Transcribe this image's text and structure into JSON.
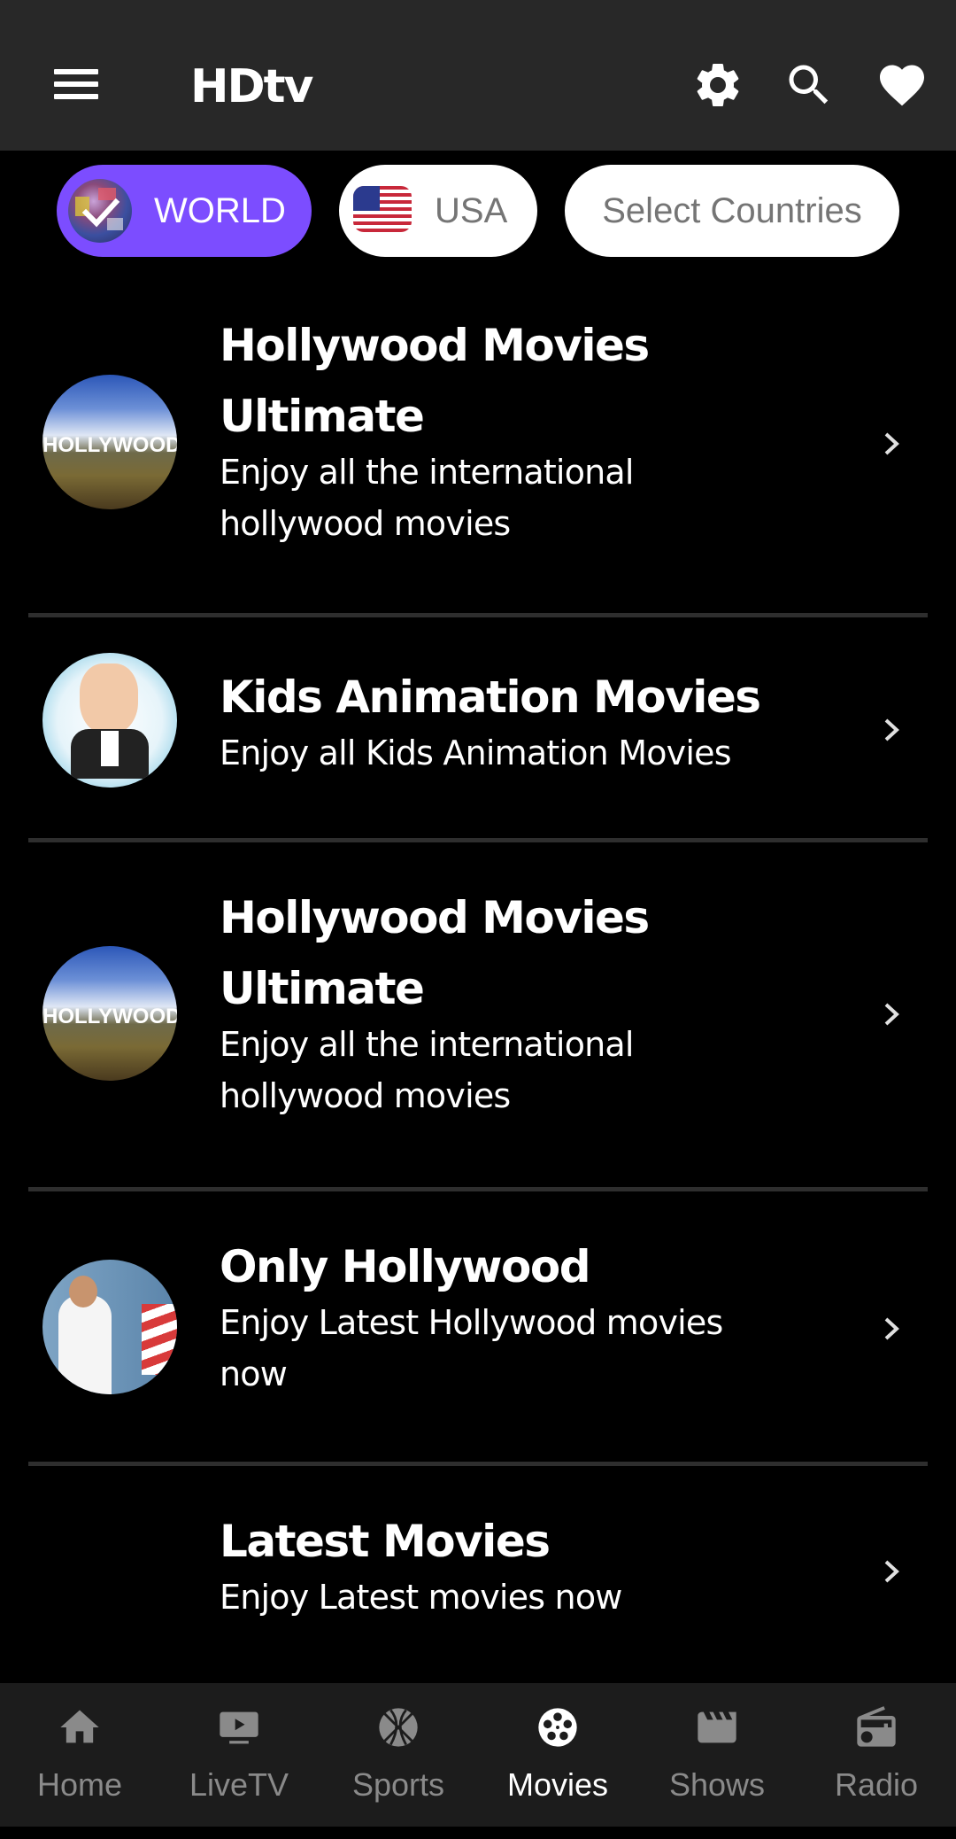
{
  "header": {
    "title": "HDtv",
    "icons": [
      "menu-icon",
      "settings-icon",
      "search-icon",
      "favorite-icon"
    ]
  },
  "chips": [
    {
      "label": "WORLD",
      "icon": "globe-check-icon",
      "selected": true,
      "color": "#7c4dff"
    },
    {
      "label": "USA",
      "icon": "usa-flag-icon",
      "selected": false
    },
    {
      "label": "Select Countries",
      "selected": false
    }
  ],
  "list": [
    {
      "title_lines": [
        "Hollywood Movies",
        "Ultimate"
      ],
      "subtitle_lines": [
        "Enjoy all the international",
        "hollywood movies"
      ],
      "image": "hollywood-sign"
    },
    {
      "title_lines": [
        "Kids Animation Movies"
      ],
      "subtitle_lines": [
        "Enjoy all  Kids Animation Movies"
      ],
      "image": "boss-baby"
    },
    {
      "title_lines": [
        "Hollywood Movies",
        "Ultimate"
      ],
      "subtitle_lines": [
        "Enjoy all the international",
        "hollywood movies"
      ],
      "image": "hollywood-sign"
    },
    {
      "title_lines": [
        "Only Hollywood"
      ],
      "subtitle_lines": [
        "Enjoy Latest Hollywood movies",
        "now"
      ],
      "image": "man-with-flag"
    },
    {
      "title_lines": [
        "Latest Movies"
      ],
      "subtitle_lines": [
        "Enjoy Latest movies now"
      ],
      "image": null
    }
  ],
  "avatar_texts": {
    "hollywood_sign": "HOLLYWOOD"
  },
  "bottom_nav": [
    {
      "label": "Home",
      "icon": "home-icon",
      "active": false
    },
    {
      "label": "LiveTV",
      "icon": "live-tv-icon",
      "active": false
    },
    {
      "label": "Sports",
      "icon": "basketball-icon",
      "active": false
    },
    {
      "label": "Movies",
      "icon": "film-reel-icon",
      "active": true
    },
    {
      "label": "Shows",
      "icon": "clapperboard-icon",
      "active": false
    },
    {
      "label": "Radio",
      "icon": "radio-icon",
      "active": false
    }
  ],
  "colors": {
    "header_bg": "#282828",
    "accent": "#7c4dff",
    "nav_bg": "#1c1c1c",
    "nav_inactive": "#8a8a8a",
    "separator": "#2e2e2e"
  }
}
